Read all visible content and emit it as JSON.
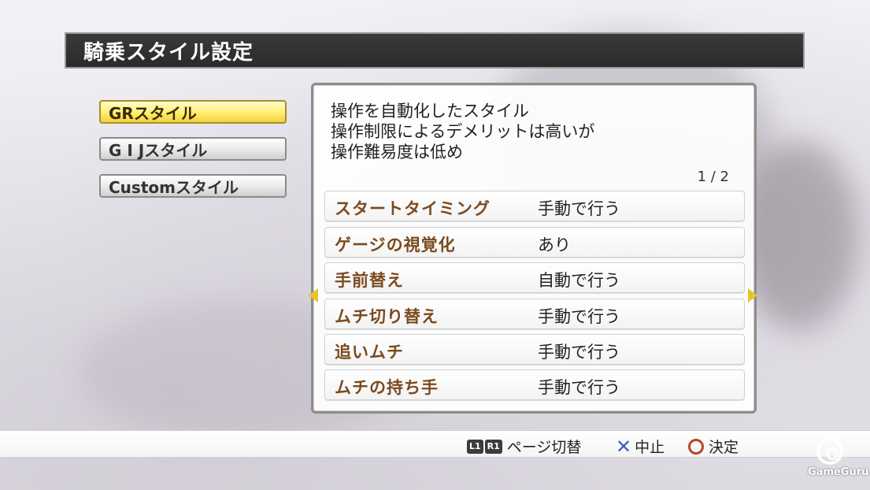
{
  "header": {
    "title": "騎乗スタイル設定"
  },
  "styles": [
    {
      "label": "GRスタイル",
      "selected": true
    },
    {
      "label": "G I Jスタイル",
      "selected": false
    },
    {
      "label": "Customスタイル",
      "selected": false
    }
  ],
  "panel": {
    "description": [
      "操作を自動化したスタイル",
      "操作制限によるデメリットは高いが",
      "操作難易度は低め"
    ],
    "page": "1 / 2",
    "settings": [
      {
        "label": "スタートタイミング",
        "value": "手動で行う"
      },
      {
        "label": "ゲージの視覚化",
        "value": "あり"
      },
      {
        "label": "手前替え",
        "value": "自動で行う"
      },
      {
        "label": "ムチ切り替え",
        "value": "手動で行う"
      },
      {
        "label": "追いムチ",
        "value": "手動で行う"
      },
      {
        "label": "ムチの持ち手",
        "value": "手動で行う"
      }
    ]
  },
  "footer": {
    "l1": "L1",
    "r1": "R1",
    "page_switch": "ページ切替",
    "cancel": "中止",
    "confirm": "決定"
  },
  "watermark": "GameGuru",
  "colors": {
    "selected": "#f0d23a",
    "label_brown": "#7a4a1e",
    "title_bar": "#2a2a2a",
    "arrow": "#e6c52a"
  },
  "icons": {
    "prev": "triangle-left",
    "next": "triangle-right",
    "cancel": "cross",
    "confirm": "circle"
  }
}
